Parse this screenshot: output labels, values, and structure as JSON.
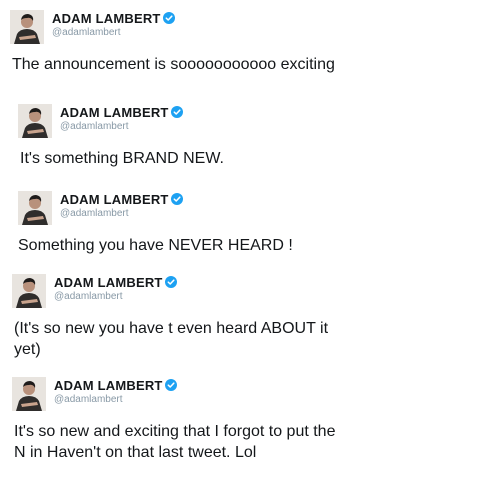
{
  "tweets": [
    {
      "name": "ADAM LAMBERT",
      "handle": "@adamlambert",
      "verified": true,
      "lines": [
        "The announcement is sooooooooooo exciting"
      ]
    },
    {
      "name": "ADAM LAMBERT",
      "handle": "@adamlambert",
      "verified": true,
      "lines": [
        "It's something BRAND NEW."
      ]
    },
    {
      "name": "ADAM LAMBERT",
      "handle": "@adamlambert",
      "verified": true,
      "lines": [
        "Something you have NEVER HEARD !"
      ]
    },
    {
      "name": "ADAM LAMBERT",
      "handle": "@adamlambert",
      "verified": true,
      "lines": [
        "(It's so new you have t even heard ABOUT it",
        "yet)"
      ]
    },
    {
      "name": "ADAM LAMBERT",
      "handle": "@adamlambert",
      "verified": true,
      "lines": [
        "It's so new and exciting that I forgot to put the",
        "N in Haven't on that last tweet. Lol"
      ]
    }
  ],
  "colors": {
    "verified_badge": "#1da1f2",
    "handle_text": "#8899a6",
    "tweet_text": "#14171a"
  },
  "icons": {
    "avatar": "profile-photo",
    "verified": "verified-check-icon"
  }
}
